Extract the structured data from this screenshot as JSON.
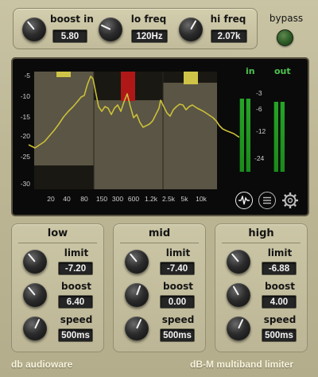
{
  "top": {
    "boost_in": {
      "label": "boost in",
      "value": "5.80"
    },
    "lo_freq": {
      "label": "lo freq",
      "value": "120Hz"
    },
    "hi_freq": {
      "label": "hi freq",
      "value": "2.07k"
    }
  },
  "bypass": {
    "label": "bypass",
    "led_color": "#2c5a25"
  },
  "display": {
    "y_axis": [
      "-5",
      "-10",
      "-15",
      "-20",
      "-25",
      "-30"
    ],
    "x_axis": [
      "20",
      "40",
      "80",
      "150",
      "300",
      "600",
      "1.2k",
      "2.5k",
      "5k",
      "10k"
    ],
    "meters": {
      "in_label": "in",
      "out_label": "out",
      "scale": [
        "-3",
        "-6",
        "-12",
        "-24"
      ],
      "in_levels": [
        0.82,
        0.82
      ],
      "out_levels": [
        0.79,
        0.79
      ]
    },
    "icons": [
      "waveform-icon",
      "list-icon",
      "gear-icon"
    ],
    "colors": {
      "curve": "#c9bf3a",
      "gr_low": "#cfc447",
      "gr_mid": "#b01818",
      "gr_high": "#cfc447",
      "meter": "#1f9a1f"
    }
  },
  "bands": [
    {
      "title": "low",
      "limit_label": "limit",
      "limit_value": "-7.20",
      "boost_label": "boost",
      "boost_value": "6.40",
      "speed_label": "speed",
      "speed_value": "500ms"
    },
    {
      "title": "mid",
      "limit_label": "limit",
      "limit_value": "-7.40",
      "boost_label": "boost",
      "boost_value": "0.00",
      "speed_label": "speed",
      "speed_value": "500ms"
    },
    {
      "title": "high",
      "limit_label": "limit",
      "limit_value": "-6.88",
      "boost_label": "boost",
      "boost_value": "4.00",
      "speed_label": "speed",
      "speed_value": "500ms"
    }
  ],
  "footer": {
    "brand": "db audioware",
    "product": "dB-M multiband limiter"
  }
}
